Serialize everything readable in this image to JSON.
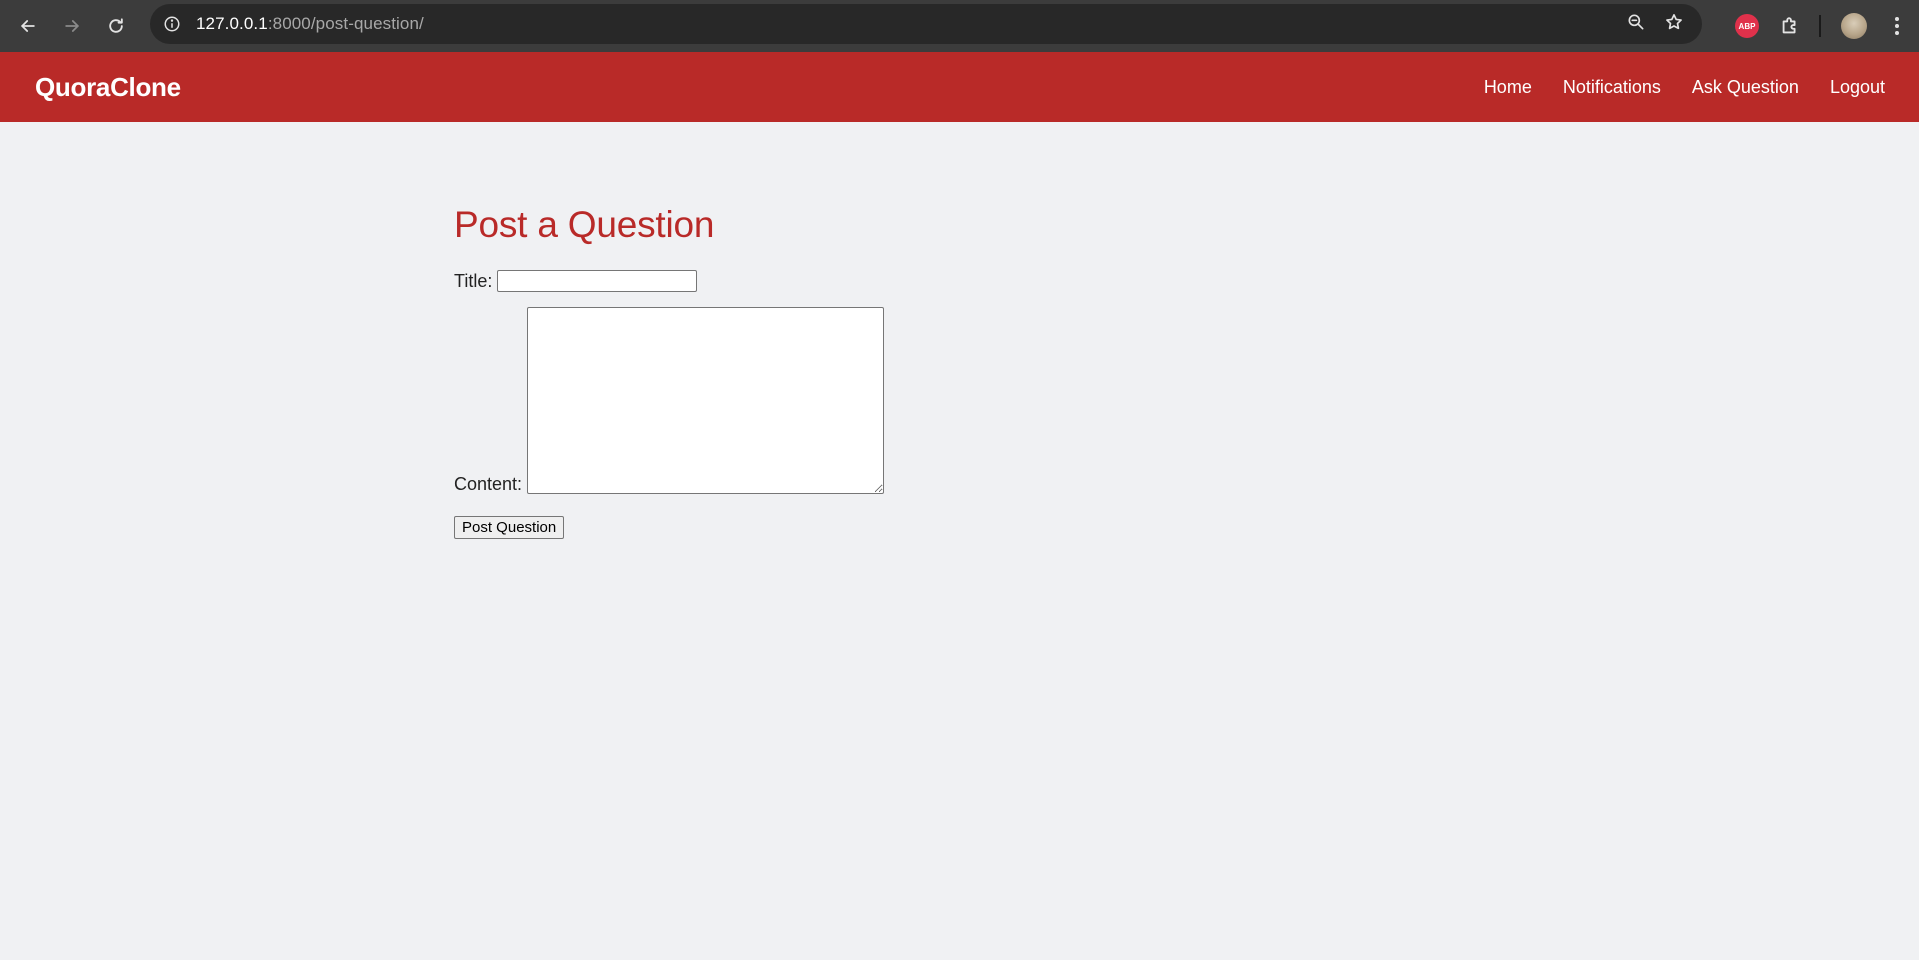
{
  "browser": {
    "url_host": "127.0.0.1",
    "url_rest": ":8000/post-question/",
    "extensions": {
      "abp_label": "ABP"
    },
    "icons": {
      "back": "arrow-left-icon",
      "forward": "arrow-right-icon",
      "reload": "reload-icon",
      "site_info": "info-icon",
      "zoom": "zoom-icon",
      "bookmark": "star-icon",
      "extensions": "puzzle-icon",
      "menu": "kebab-menu-icon"
    }
  },
  "header": {
    "brand": "QuoraClone",
    "nav": [
      {
        "label": "Home"
      },
      {
        "label": "Notifications"
      },
      {
        "label": "Ask Question"
      },
      {
        "label": "Logout"
      }
    ]
  },
  "form": {
    "heading": "Post a Question",
    "title_label": "Title:",
    "title_value": "",
    "content_label": "Content:",
    "content_value": "",
    "submit_label": "Post Question"
  },
  "colors": {
    "brand_red": "#b92a28",
    "page_background": "#f0f1f3",
    "browser_chrome": "#3c3c3c"
  }
}
